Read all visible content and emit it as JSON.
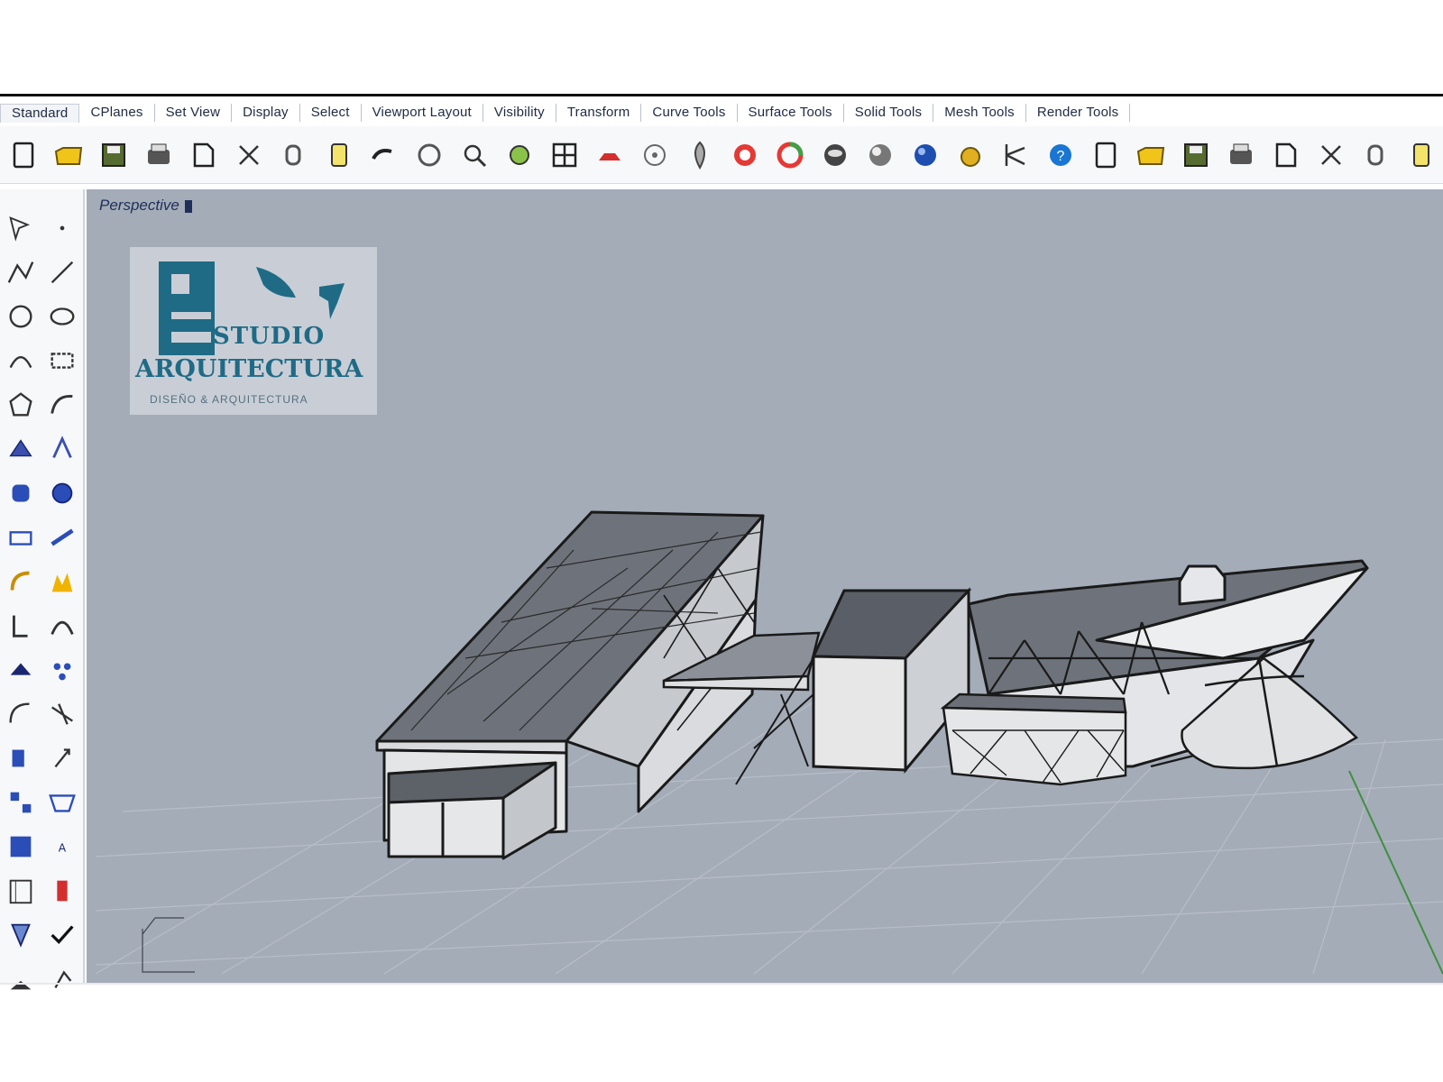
{
  "tabs": [
    {
      "label": "Standard"
    },
    {
      "label": "CPlanes"
    },
    {
      "label": "Set View"
    },
    {
      "label": "Display"
    },
    {
      "label": "Select"
    },
    {
      "label": "Viewport Layout"
    },
    {
      "label": "Visibility"
    },
    {
      "label": "Transform"
    },
    {
      "label": "Curve Tools"
    },
    {
      "label": "Surface Tools"
    },
    {
      "label": "Solid Tools"
    },
    {
      "label": "Mesh Tools"
    },
    {
      "label": "Render Tools"
    }
  ],
  "toolbar_icons": [
    "new-icon",
    "open-icon",
    "save-icon",
    "print-icon",
    "import-icon",
    "cut-icon",
    "copy-icon",
    "paste-icon",
    "undo-icon",
    "pan-icon",
    "rotate-view-icon",
    "zoom-icon",
    "zoom-window-icon",
    "zoom-extents-icon",
    "zoom-selected-icon",
    "cplane-icon",
    "four-view-icon",
    "layer-icon",
    "hide-icon",
    "snap-icon",
    "lights-icon",
    "lock-icon",
    "wireframe-icon",
    "shaded-icon",
    "rendered-icon",
    "color-wheel-icon",
    "ghosted-icon",
    "xray-icon",
    "material-sphere-icon",
    "options-icon",
    "properties-icon",
    "help-icon"
  ],
  "sidebar_icons": [
    "select-icon",
    "point-icon",
    "polyline-icon",
    "line-icon",
    "circle-icon",
    "ellipse-icon",
    "arc-icon",
    "rectangle-icon",
    "polygon-icon",
    "curve-icon",
    "surface-icon",
    "patch-icon",
    "extrude-icon",
    "solid-icon",
    "box-icon",
    "sweep-icon",
    "fillet-icon",
    "chamfer-icon",
    "offset-icon",
    "blend-icon",
    "mesh-icon",
    "points-icon",
    "trim-icon",
    "split-icon",
    "join-icon",
    "explode-icon",
    "group-icon",
    "array-icon",
    "dimension-icon",
    "text-icon",
    "block-icon",
    "pin-icon",
    "camera-icon",
    "check-icon",
    "misc-icon",
    "plugin-icon"
  ],
  "viewport": {
    "title": "Perspective"
  },
  "logo": {
    "line1": "STUDIO",
    "line2": "ARQUITECTURA",
    "tagline": "DISEÑO & ARQUITECTURA"
  },
  "colors": {
    "viewport_bg": "#a4acb8",
    "accent": "#1f6b86",
    "tab_text": "#1e2a44"
  }
}
